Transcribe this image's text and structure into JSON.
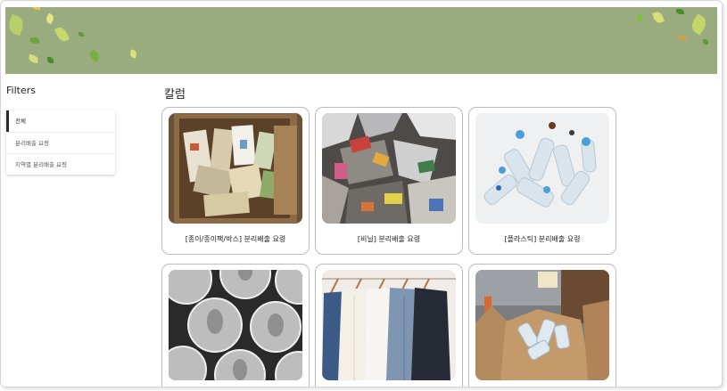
{
  "sidebar": {
    "title": "Filters",
    "items": [
      {
        "label": "전체"
      },
      {
        "label": "분리배출 요령"
      },
      {
        "label": "지역별 분리배출 요령"
      }
    ]
  },
  "main": {
    "title": "칼럼",
    "cards": [
      {
        "label": "[종이/종이팩/박스] 분리배출 요령",
        "image": "paper-box-photo"
      },
      {
        "label": "[비닐] 분리배출 요령",
        "image": "vinyl-pile-photo"
      },
      {
        "label": "[플라스틱] 분리배출 요령",
        "image": "plastic-bottles-photo"
      },
      {
        "label": "",
        "image": "aluminum-cans-photo"
      },
      {
        "label": "",
        "image": "clothes-rack-photo"
      },
      {
        "label": "",
        "image": "recycling-sacks-photo"
      }
    ]
  },
  "colors": {
    "banner": "#9aab80",
    "leaf_green": "#7fc23a",
    "leaf_yellow": "#d8e07a",
    "accent_bar": "#2b2b2b"
  }
}
